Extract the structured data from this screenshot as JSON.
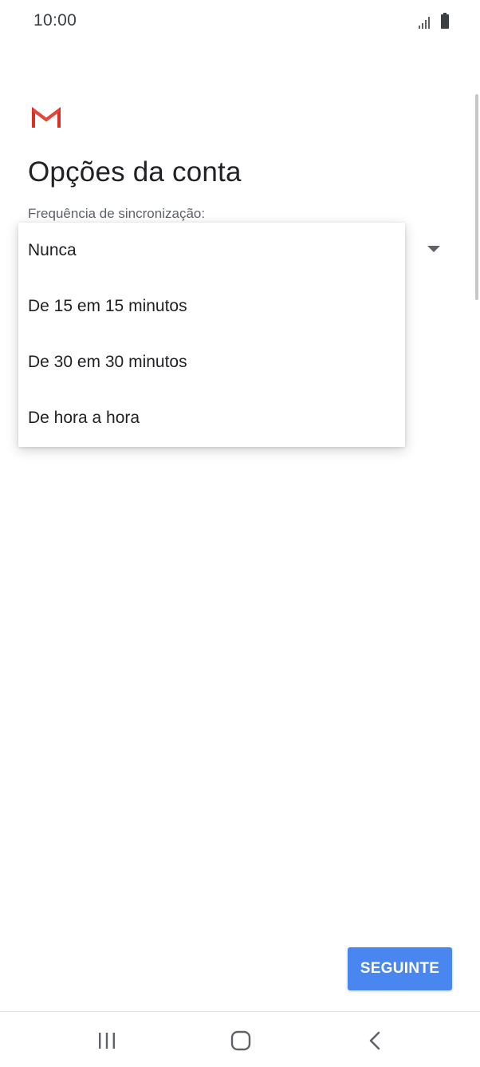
{
  "status_bar": {
    "time": "10:00",
    "icons": [
      "signal-icon",
      "battery-icon"
    ]
  },
  "app": {
    "logo": "gmail-logo",
    "title": "Opções da conta"
  },
  "sync_field": {
    "label": "Frequência de sincronização:",
    "options": [
      "Nunca",
      "De 15 em 15 minutos",
      "De 30 em 30 minutos",
      "De hora a hora"
    ]
  },
  "actions": {
    "next_label": "SEGUINTE"
  },
  "nav_bar": {
    "icons": [
      "recents-icon",
      "home-icon",
      "back-icon"
    ]
  },
  "colors": {
    "accent": "#4a86f0",
    "gmail_red": "#d93025"
  }
}
